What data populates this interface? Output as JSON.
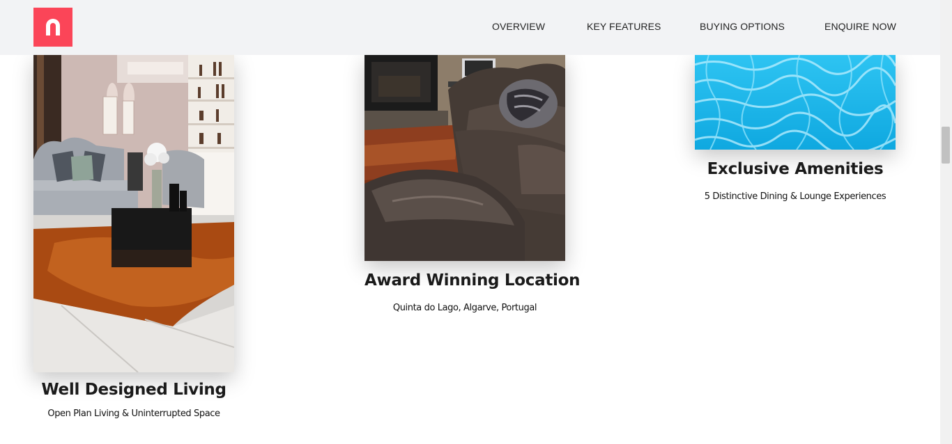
{
  "brand": {
    "logo_icon": "n-logo-icon",
    "accent_color": "#fb4558"
  },
  "nav": {
    "items": [
      {
        "label": "OVERVIEW"
      },
      {
        "label": "KEY FEATURES"
      },
      {
        "label": "BUYING OPTIONS"
      },
      {
        "label": "ENQUIRE NOW"
      }
    ]
  },
  "features": [
    {
      "title": "Well Designed Living",
      "subtitle": "Open Plan Living & Uninterrupted Space",
      "image": "living-room-image"
    },
    {
      "title": "Award Winning Location",
      "subtitle": "Quinta do Lago, Algarve, Portugal",
      "image": "leather-sofa-image"
    },
    {
      "title": "Exclusive Amenities",
      "subtitle": "5 Distinctive Dining & Lounge Experiences",
      "image": "pool-water-image"
    }
  ]
}
